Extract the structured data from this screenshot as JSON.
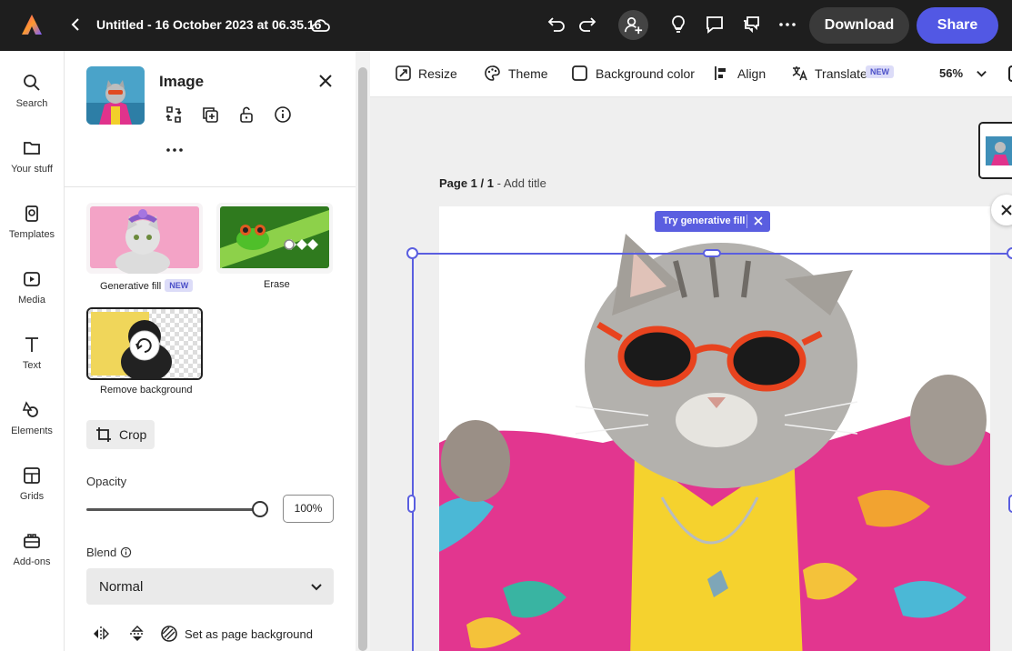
{
  "topbar": {
    "title": "Untitled - 16 October 2023 at 06.35.16",
    "download_label": "Download",
    "share_label": "Share",
    "icons": [
      "adobe-express-logo",
      "back-chevron-icon",
      "cloud-icon",
      "undo-icon",
      "redo-icon",
      "invite-user-icon",
      "lightbulb-icon",
      "comment-icon",
      "chat-icon",
      "more-icon"
    ]
  },
  "rail": {
    "items": [
      {
        "label": "Search",
        "icon": "search-icon"
      },
      {
        "label": "Your stuff",
        "icon": "folder-icon"
      },
      {
        "label": "Templates",
        "icon": "templates-icon"
      },
      {
        "label": "Media",
        "icon": "media-icon"
      },
      {
        "label": "Text",
        "icon": "text-icon"
      },
      {
        "label": "Elements",
        "icon": "elements-icon"
      },
      {
        "label": "Grids",
        "icon": "grids-icon"
      },
      {
        "label": "Add-ons",
        "icon": "add-ons-icon"
      }
    ]
  },
  "panel": {
    "title": "Image",
    "tiles": [
      {
        "label": "Generative fill",
        "badge": "NEW"
      },
      {
        "label": "Erase",
        "badge": ""
      },
      {
        "label": "Remove background",
        "badge": ""
      }
    ],
    "crop_label": "Crop",
    "opacity_label": "Opacity",
    "opacity_value": "100%",
    "opacity_fraction": 1.0,
    "blend_label": "Blend",
    "blend_value": "Normal",
    "page_bg_label": "Set as page background"
  },
  "toolbar": {
    "resize": "Resize",
    "theme": "Theme",
    "background_color": "Background color",
    "align": "Align",
    "translate": "Translate",
    "translate_badge": "NEW",
    "zoom": "56%"
  },
  "canvas": {
    "page_label_bold": "Page 1 / 1",
    "page_label_rest": " - Add title",
    "generative_pill": "Try generative fill"
  },
  "colors": {
    "topbar_bg": "#1e1e1e",
    "accent": "#5258e4",
    "selection": "#5a5ee0",
    "canvas_bg": "#efefef"
  }
}
